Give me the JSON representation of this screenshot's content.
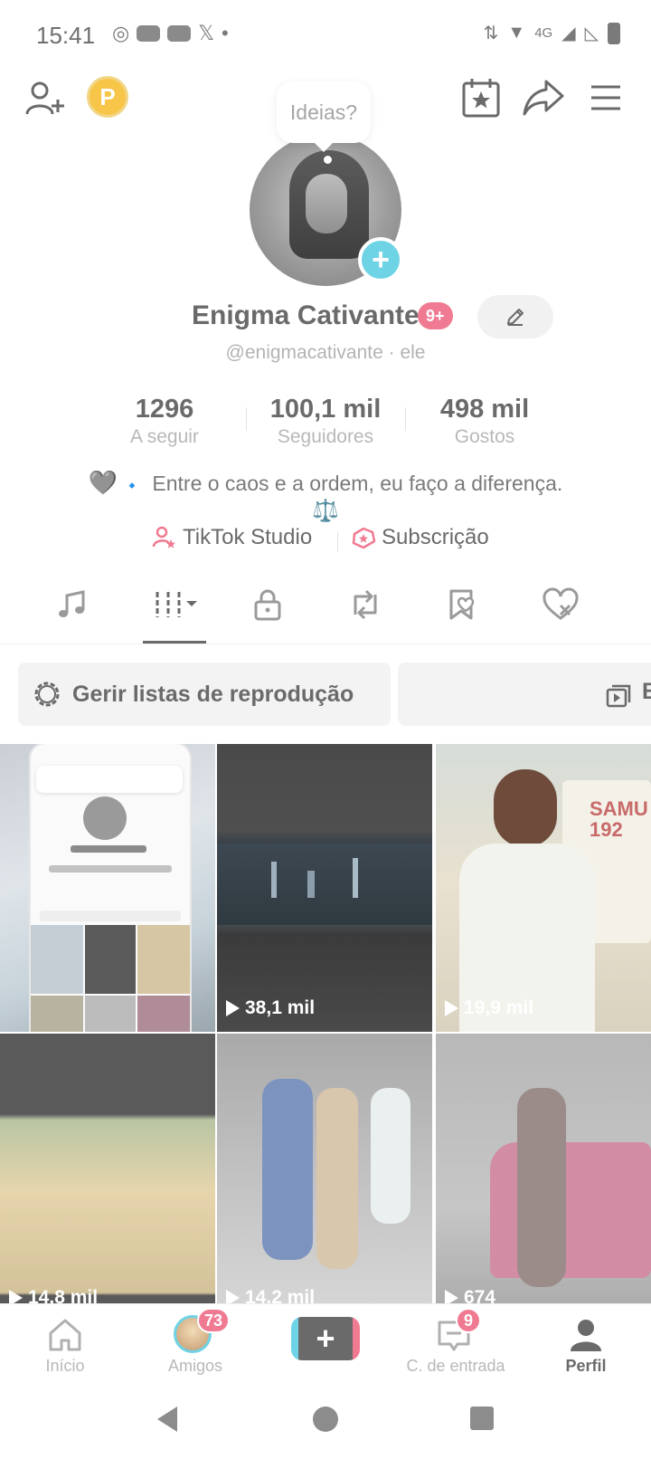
{
  "status_bar": {
    "time": "15:41",
    "network": "4G"
  },
  "ideas_bubble": "Ideias?",
  "profile": {
    "name": "Enigma Cativante",
    "name_badge": "9+",
    "username_line": "@enigmacativante · ele",
    "coin_letter": "P"
  },
  "stats": [
    {
      "value": "1296",
      "label": "A seguir"
    },
    {
      "value": "100,1 mil",
      "label": "Seguidores"
    },
    {
      "value": "498 mil",
      "label": "Gostos"
    }
  ],
  "bio": {
    "heart": "🩶",
    "diamond": "🔹",
    "text": "Entre o caos e a ordem, eu faço a diferença.",
    "scales": "⚖️"
  },
  "links": {
    "studio": "TikTok Studio",
    "subscription": "Subscrição"
  },
  "tabs": [
    "music-icon",
    "videos-grid-icon",
    "lock-icon",
    "repost-icon",
    "favorites-icon",
    "liked-icon"
  ],
  "playlist": {
    "label": "Gerir listas de reprodução",
    "second_label_partial": "B"
  },
  "grid": [
    {
      "views": "",
      "kind": "screenshot"
    },
    {
      "views": "38,1 mil",
      "kind": "city-night"
    },
    {
      "views": "19,9 mil",
      "kind": "doctor"
    },
    {
      "views": "14,8 mil",
      "kind": "beach"
    },
    {
      "views": "14,2 mil",
      "kind": "group"
    },
    {
      "views": "674",
      "kind": "pink-car"
    }
  ],
  "bottom_nav": {
    "home": "Início",
    "friends": "Amigos",
    "friends_badge": "73",
    "create": "+",
    "inbox": "C. de entrada",
    "inbox_badge": "9",
    "profile": "Perfil"
  },
  "colors": {
    "accent_pink": "#f07a92",
    "accent_cyan": "#6fd3e6",
    "text_dim": "#6a6a6a",
    "coin": "#f7c548"
  }
}
